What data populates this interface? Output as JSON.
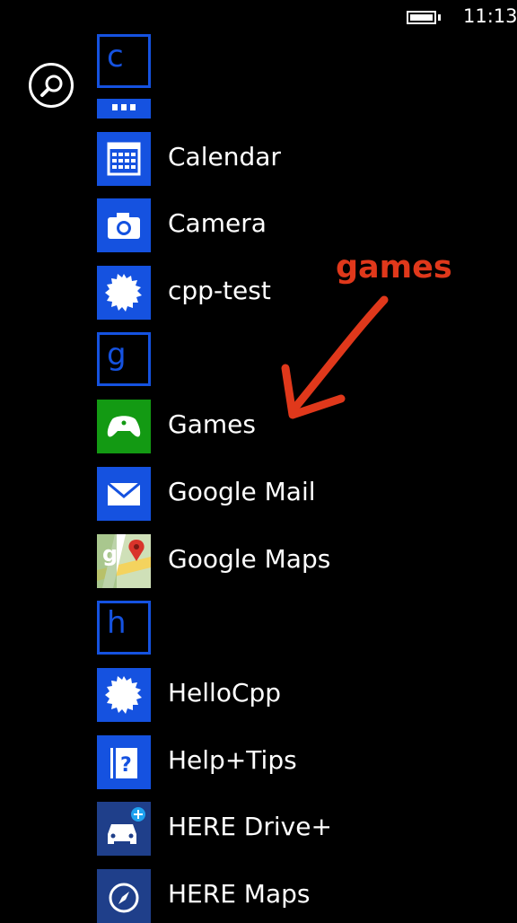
{
  "status": {
    "time": "11:13"
  },
  "letters": {
    "c": "c",
    "g": "g",
    "h": "h"
  },
  "apps": {
    "calendar": "Calendar",
    "camera": "Camera",
    "cpp_test": "cpp-test",
    "games": "Games",
    "google_mail": "Google Mail",
    "google_maps": "Google Maps",
    "hellocpp": "HelloCpp",
    "help_tips": "Help+Tips",
    "here_drive": "HERE Drive+",
    "here_maps": "HERE Maps"
  },
  "annotation": {
    "text": "games"
  },
  "colors": {
    "accent": "#1552e0",
    "games_tile": "#139a13",
    "annotation": "#e0381b"
  }
}
